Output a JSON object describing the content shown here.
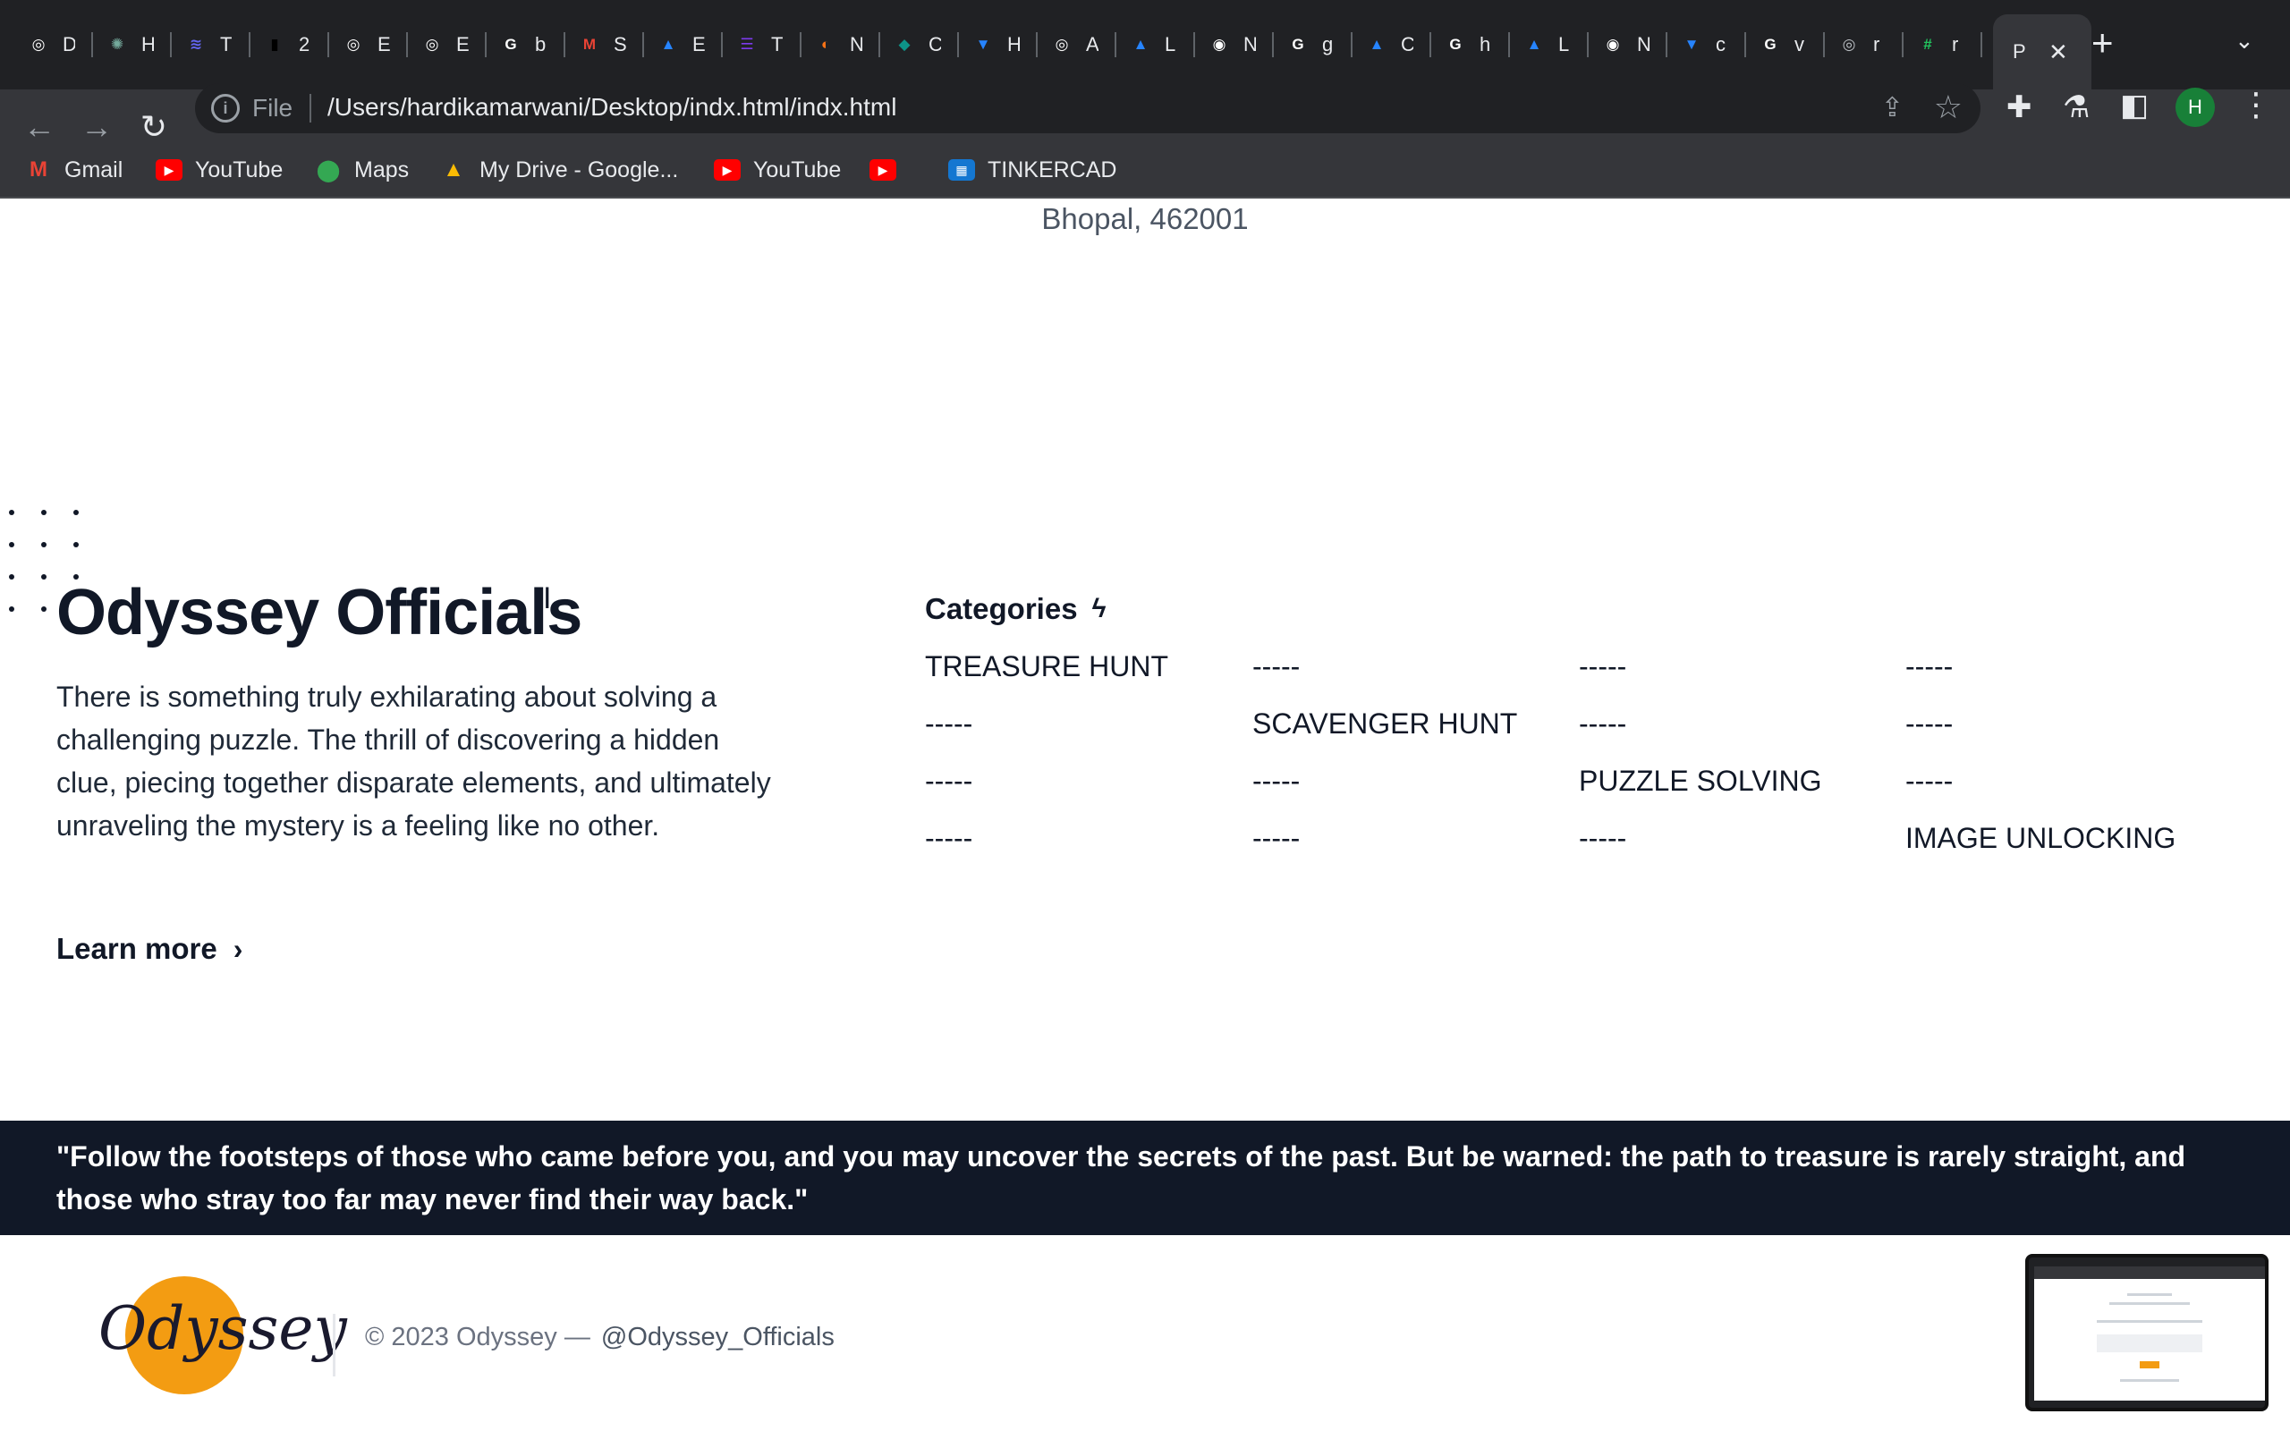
{
  "browser": {
    "tabs": [
      {
        "letter": "D",
        "icon": "globe-icon",
        "color": "#ffffff"
      },
      {
        "letter": "H",
        "icon": "chatgpt-icon",
        "color": "#74aa9c"
      },
      {
        "letter": "T",
        "icon": "stack-icon",
        "color": "#6366f1"
      },
      {
        "letter": "2",
        "icon": "bars-icon",
        "color": "#000000"
      },
      {
        "letter": "E",
        "icon": "globe-icon",
        "color": "#ffffff"
      },
      {
        "letter": "E",
        "icon": "globe-icon",
        "color": "#ffffff"
      },
      {
        "letter": "b",
        "icon": "google-icon",
        "color": "#ffffff"
      },
      {
        "letter": "S",
        "icon": "gmail-icon",
        "color": "#ea4335"
      },
      {
        "letter": "E",
        "icon": "atlassian-icon",
        "color": "#2684ff"
      },
      {
        "letter": "T",
        "icon": "list-icon",
        "color": "#7c3aed"
      },
      {
        "letter": "N",
        "icon": "eclipse-icon",
        "color": "#f97316"
      },
      {
        "letter": "C",
        "icon": "diamond-icon",
        "color": "#0d9488"
      },
      {
        "letter": "H",
        "icon": "bitbucket-icon",
        "color": "#2684ff"
      },
      {
        "letter": "A",
        "icon": "globe-icon",
        "color": "#ffffff"
      },
      {
        "letter": "L",
        "icon": "atlassian-icon",
        "color": "#2684ff"
      },
      {
        "letter": "N",
        "icon": "chrome-icon",
        "color": "#ffffff"
      },
      {
        "letter": "g",
        "icon": "google-icon",
        "color": "#ffffff"
      },
      {
        "letter": "C",
        "icon": "atlassian-icon",
        "color": "#2684ff"
      },
      {
        "letter": "h",
        "icon": "google-icon",
        "color": "#ffffff"
      },
      {
        "letter": "L",
        "icon": "atlassian-icon",
        "color": "#2684ff"
      },
      {
        "letter": "N",
        "icon": "chrome-icon",
        "color": "#ffffff"
      },
      {
        "letter": "c",
        "icon": "bitbucket-icon",
        "color": "#2684ff"
      },
      {
        "letter": "v",
        "icon": "google-icon",
        "color": "#ffffff"
      },
      {
        "letter": "r",
        "icon": "globe-icon",
        "color": "#bdc1c6"
      },
      {
        "letter": "r",
        "icon": "hashtag-icon",
        "color": "#22c55e"
      }
    ],
    "active_tab": {
      "letter": "P",
      "close": "✕"
    },
    "new_tab": "+",
    "tab_list": "⌄",
    "nav": {
      "back": "←",
      "forward": "→",
      "reload": "↻"
    },
    "address": {
      "scheme": "File",
      "url": "/Users/hardikamarwani/Desktop/indx.html/indx.html"
    },
    "profile_initial": "H",
    "bookmarks": [
      {
        "label": "Gmail",
        "icon": "gmail-icon",
        "color": "#ea4335"
      },
      {
        "label": "YouTube",
        "icon": "youtube-icon",
        "color": "#ff0000"
      },
      {
        "label": "Maps",
        "icon": "maps-icon",
        "color": "#34a853"
      },
      {
        "label": "My Drive - Google...",
        "icon": "drive-icon",
        "color": "#fbbc04"
      },
      {
        "label": "YouTube",
        "icon": "youtube-icon",
        "color": "#ff0000"
      },
      {
        "label": "",
        "icon": "youtube-icon",
        "color": "#ff0000"
      },
      {
        "label": "TINKERCAD",
        "icon": "tinkercad-icon",
        "color": "#1477d1"
      }
    ]
  },
  "page": {
    "address_line": "Bhopal, 462001",
    "brand": {
      "title": "Odyssey Officials",
      "description": "There is something truly exhilarating about solving a challenging puzzle. The thrill of discovering a hidden clue, piecing together disparate elements, and ultimately unraveling the mystery is a feeling like no other.",
      "learn_more": "Learn more"
    },
    "categories": {
      "title": "Categories",
      "rows": [
        [
          "TREASURE HUNT",
          "-----",
          "-----",
          "-----"
        ],
        [
          "-----",
          "SCAVENGER HUNT",
          "-----",
          "-----"
        ],
        [
          "-----",
          "-----",
          "PUZZLE SOLVING",
          "-----"
        ],
        [
          "-----",
          "-----",
          "-----",
          "IMAGE UNLOCKING"
        ]
      ]
    },
    "quote": "\"Follow the footsteps of those who came before you, and you may uncover the secrets of the past. But be warned: the path to treasure is rarely straight, and those who stray too far may never find their way back.\"",
    "footer": {
      "logo_text": "Odyssey",
      "copyright": "© 2023 Odyssey —",
      "handle": "@Odyssey_Officials"
    }
  },
  "colors": {
    "chrome_dark": "#202124",
    "chrome_toolbar": "#35363a",
    "quote_band": "#111827",
    "logo_sun": "#f39c12"
  }
}
